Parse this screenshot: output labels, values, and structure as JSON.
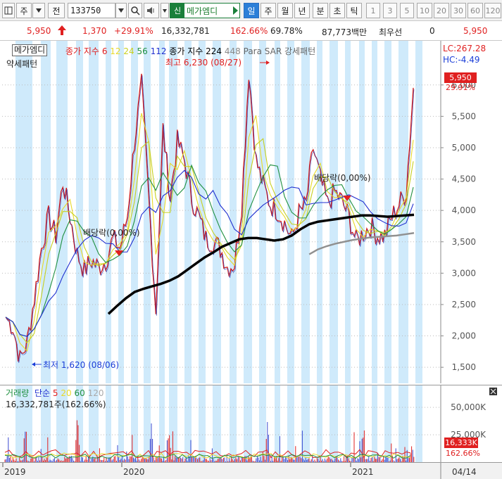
{
  "toolbar": {
    "market": "주",
    "prev": "전",
    "code": "133750",
    "stock_badge": "신",
    "stock_name": "메가엠디",
    "periods": [
      "일",
      "주",
      "월",
      "년",
      "분",
      "초",
      "틱"
    ],
    "selected_period": "일",
    "intervals": [
      "1",
      "3",
      "5",
      "10",
      "20",
      "30",
      "60",
      "120"
    ]
  },
  "quote": {
    "price": "5,950",
    "change": "1,370",
    "change_pct": "+29.91%",
    "volume": "16,332,781",
    "volume_ratio": "162.66%",
    "turnover": "69.78%",
    "amount": "87,773백만",
    "bid_label": "최우선",
    "bid_value": "0",
    "ask_value": "5,950"
  },
  "legend": {
    "stock_tag": "메가엠디",
    "ma_title": "종가 지수",
    "ma_periods": [
      "6",
      "12",
      "24",
      "56",
      "112"
    ],
    "ma_colors": [
      "#e02020",
      "#e8d92a",
      "#c8d020",
      "#209040",
      "#2030d0"
    ],
    "ma2_title": "종가 지수",
    "ma2_periods": [
      "224",
      "448"
    ],
    "sar_label": "Para SAR 강세패턴",
    "sar_sub": "약세패턴",
    "lc_label": "LC:267.28",
    "hc_label": "HC:-4.49"
  },
  "annotations": {
    "high": "최고 6,230 (08/27)",
    "low": "최저 1,620 (08/06)",
    "div1": "배당락(0,00%)",
    "div2": "배당락(0,00%)"
  },
  "price_labels": {
    "current": "5,950",
    "pct": "29.91%"
  },
  "volume_panel": {
    "title": "거래량",
    "ma_title": "단순",
    "ma_periods": [
      "5",
      "20",
      "60",
      "120"
    ],
    "ma_colors": [
      "#e02020",
      "#e8d92a",
      "#209040",
      "#aaaaaa"
    ],
    "summary": "16,332,781주(162.66%)",
    "current": "16,333K",
    "pct": "162.66%"
  },
  "chart_data": {
    "type": "line",
    "price_axis": {
      "ticks": [
        1500,
        2000,
        2500,
        3000,
        3500,
        4000,
        4500,
        5000,
        5500,
        6000
      ],
      "tick_labels": [
        "1,500",
        "2,000",
        "2,500",
        "3,000",
        "3,500",
        "4,000",
        "4,500",
        "5,000",
        "5,500",
        "6,000"
      ],
      "ylim": [
        1300,
        6300
      ]
    },
    "volume_axis": {
      "ticks": [
        25000,
        50000
      ],
      "tick_labels": [
        "25,000K",
        "50,000K"
      ],
      "ylim": [
        0,
        70000
      ]
    },
    "x_labels": [
      "2019",
      "2020",
      "2021",
      "04/14"
    ],
    "series": [
      {
        "name": "종가",
        "values": [
          2300,
          2150,
          1620,
          1900,
          2600,
          3400,
          3900,
          3600,
          4450,
          3900,
          3300,
          3050,
          3200,
          3100,
          3200,
          3550,
          3400,
          3900,
          5100,
          6000,
          4200,
          2400,
          5300,
          4200,
          5100,
          4800,
          4200,
          3900,
          3550,
          3500,
          3400,
          3100,
          3150,
          4100,
          6230,
          4800,
          4400,
          4100,
          4000,
          3800,
          3550,
          3950,
          4100,
          5000,
          4500,
          4100,
          4300,
          4150,
          3900,
          3500,
          3650,
          3750,
          3600,
          3600,
          3900,
          4100,
          4300,
          5950
        ]
      },
      {
        "name": "224",
        "values": [
          null,
          null,
          null,
          null,
          null,
          2350,
          2480,
          2600,
          2700,
          2750,
          2790,
          2830,
          2880,
          2950,
          3050,
          3150,
          3250,
          3330,
          3420,
          3480,
          3540,
          3560,
          3560,
          3540,
          3520,
          3540,
          3600,
          3700,
          3780,
          3820,
          3840,
          3860,
          3880,
          3900,
          3920,
          3920,
          3910,
          3900,
          3910,
          3920,
          3930
        ]
      },
      {
        "name": "448",
        "values": [
          null,
          null,
          null,
          null,
          null,
          null,
          null,
          null,
          null,
          null,
          null,
          null,
          null,
          null,
          null,
          null,
          null,
          null,
          null,
          null,
          null,
          null,
          null,
          null,
          null,
          null,
          null,
          null,
          3300,
          3380,
          3430,
          3470,
          3500,
          3530,
          3550,
          3570,
          3580,
          3590,
          3600,
          3620,
          3640
        ]
      }
    ],
    "high": {
      "value": 6230,
      "date": "08/27"
    },
    "low": {
      "value": 1620,
      "date": "08/06"
    },
    "current": 5950,
    "current_volume_k": 16333
  }
}
